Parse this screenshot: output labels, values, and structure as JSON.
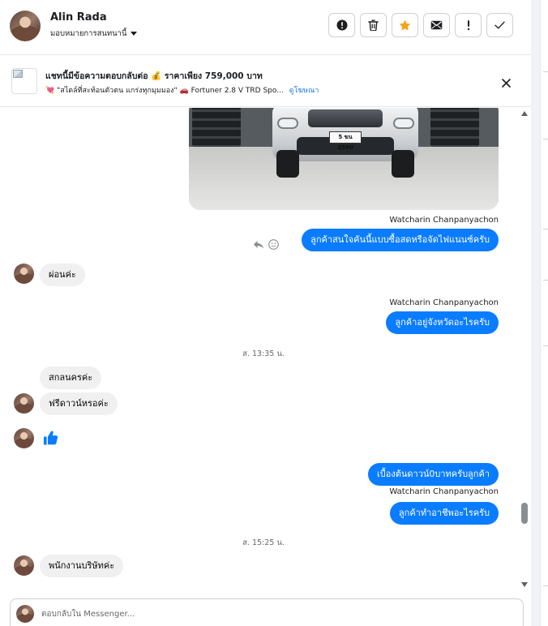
{
  "header": {
    "name": "Alin Rada",
    "assign_label": "มอบหมายการสนทนานี้",
    "actions": [
      {
        "icon": "alert-circle-icon",
        "label": "Mark as spam"
      },
      {
        "icon": "trash-icon",
        "label": "Delete"
      },
      {
        "icon": "star-icon",
        "label": "Follow up"
      },
      {
        "icon": "envelope-icon",
        "label": "Mark as unread"
      },
      {
        "icon": "exclamation-icon",
        "label": "Priority"
      },
      {
        "icon": "check-icon",
        "label": "Mark as done"
      }
    ]
  },
  "ad_banner": {
    "title": "แชทนี้มีข้อความตอบกลับต่อ 💰 ราคาเพียง 759,000 บาท",
    "subtitle": "💘 \"สไตล์ที่สะท้อนตัวตน แกร่งทุกมุมมอง\" 🚗 Fortuner 2.8 V TRD Spo...",
    "link": "ดูโฆษณา"
  },
  "conversation": {
    "plate_text": "5 ฆน 2590",
    "messages": [
      {
        "type": "sender",
        "text": "Watcharin Chanpanyachon"
      },
      {
        "type": "outgoing",
        "text": "ลูกค้าสนใจคันนี้แบบซื้อสดหรือจัดไฟแนนซ์ครับ"
      },
      {
        "type": "incoming",
        "text": "ผ่อนค่ะ"
      },
      {
        "type": "sender",
        "text": "Watcharin Chanpanyachon"
      },
      {
        "type": "outgoing",
        "text": "ลูกค้าอยู่จังหวัดอะไรครับ"
      },
      {
        "type": "timestamp",
        "text": "ส. 13:35 น."
      },
      {
        "type": "incoming",
        "text": "สกลนครค่ะ"
      },
      {
        "type": "incoming",
        "text": "ฟรีดาวน์หรอค่ะ"
      },
      {
        "type": "incoming-like",
        "icon": "thumbs-up-icon"
      },
      {
        "type": "outgoing",
        "text": "เบื้องต้นดาวน์0บาทครับลูกค้า"
      },
      {
        "type": "sender",
        "text": "Watcharin Chanpanyachon"
      },
      {
        "type": "outgoing",
        "text": "ลูกค้าทำอาชีพอะไรครับ"
      },
      {
        "type": "timestamp",
        "text": "ส. 15:25 น."
      },
      {
        "type": "incoming",
        "text": "พนักงานบริษัทค่ะ"
      }
    ]
  },
  "composer": {
    "placeholder": "ตอบกลับใน Messenger..."
  },
  "colors": {
    "outgoing_bubble": "#0a7cff",
    "incoming_bubble": "#f0f0f0",
    "link": "#1a73e8",
    "star": "#f7a21b"
  }
}
